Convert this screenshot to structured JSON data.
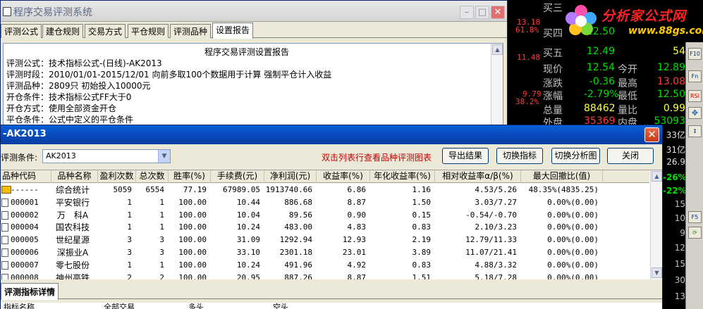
{
  "quote": {
    "left_numbers": [
      {
        "text": "13.18",
        "color": "#ff3b3b"
      },
      {
        "text": "61.8%",
        "color": "#ff3b3b"
      },
      {
        "text": "11.48",
        "color": "#ff3b3b"
      },
      {
        "text": "9.79",
        "color": "#ff3b3b"
      },
      {
        "text": "38.2%",
        "color": "#ff3b3b"
      }
    ],
    "rows": [
      {
        "l1": "买三",
        "v1": "",
        "l2": "",
        "v2": "",
        "c1": "w",
        "c2": "w"
      },
      {
        "l1": "买四",
        "v1": "12.50",
        "l2": "",
        "v2": "",
        "c1": "g",
        "c2": "y"
      },
      {
        "l1": "买五",
        "v1": "12.49",
        "l2": "",
        "v2": "54",
        "c1": "g",
        "c2": "y"
      },
      {
        "l1": "现价",
        "v1": "12.54",
        "l2": "今开",
        "v2": "12.89",
        "c1": "g",
        "c2": "g"
      },
      {
        "l1": "涨跌",
        "v1": "-0.36",
        "l2": "最高",
        "v2": "13.08",
        "c1": "g",
        "c2": "r"
      },
      {
        "l1": "涨幅",
        "v1": "-2.79%",
        "l2": "最低",
        "v2": "12.50",
        "c1": "g",
        "c2": "g"
      },
      {
        "l1": "总量",
        "v1": "88462",
        "l2": "量比",
        "v2": "0.99",
        "c1": "y",
        "c2": "y"
      },
      {
        "l1": "外盘",
        "v1": "35369",
        "l2": "内盘",
        "v2": "53093",
        "c1": "r",
        "c2": "g"
      }
    ],
    "side_values": [
      {
        "text": "33亿",
        "color": "#e0e0e0"
      },
      {
        "text": "31亿",
        "color": "#e0e0e0"
      },
      {
        "text": "26.9",
        "color": "#e0e0e0"
      },
      {
        "text": "-26%",
        "color": "#00e000"
      },
      {
        "text": "-22%",
        "color": "#00e000"
      },
      {
        "text": "15",
        "color": "#c0c0c0"
      },
      {
        "text": "10",
        "color": "#c0c0c0"
      },
      {
        "text": "9",
        "color": "#c0c0c0"
      },
      {
        "text": "12",
        "color": "#c0c0c0"
      },
      {
        "text": "15",
        "color": "#c0c0c0"
      },
      {
        "text": "30",
        "color": "#c0c0c0"
      },
      {
        "text": "13",
        "color": "#c0c0c0"
      }
    ],
    "strip_buttons": [
      "F10",
      "Fn",
      "F5"
    ]
  },
  "logo": {
    "title": "分析家公式网",
    "url": "www.88gs.com"
  },
  "settings_window": {
    "title": "程序交易评测系统",
    "tabs": [
      "评测公式",
      "建仓规则",
      "交易方式",
      "平仓规则",
      "评测品种",
      "设置报告"
    ],
    "report": {
      "title": "程序交易评测设置报告",
      "lines": [
        "评测公式：技术指标公式-(日线)-AK2013",
        "评测时段：2010/01/01-2015/12/01 向前多取100个数据用于计算 强制平仓计入收益",
        "评测品种：2809只 初始投入10000元",
        "开仓条件：技术指标公式FF大于0",
        "开仓方式：使用全部资金开仓",
        "平仓条件：公式中定义的平仓条件"
      ]
    }
  },
  "result_window": {
    "title": "-AK2013",
    "condition_label": "评测条件:",
    "condition_value": "AK2013",
    "hint": "双击列表行查看品种评测图表",
    "buttons": {
      "export": "导出结果",
      "switch_indicator": "切换指标",
      "switch_chart": "切换分析图",
      "close": "关闭"
    },
    "columns": [
      "品种代码",
      "品种名称",
      "盈利次数",
      "总次数",
      "胜率(%)",
      "手续费(元)",
      "净利润(元)",
      "收益率(%)",
      "年化收益率(%)",
      "相对收益率α/β(%)",
      "最大回撤比(值)"
    ],
    "rows": [
      {
        "code": "------",
        "name": "综合统计",
        "wins": "5059",
        "total": "6554",
        "winrate": "77.19",
        "fee": "67989.05",
        "profit": "1913740.66",
        "ret": "6.86",
        "annual": "1.16",
        "relative": "4.53/5.26",
        "drawdown": "48.35%(4835.25)",
        "summary": true
      },
      {
        "code": "000001",
        "name": "平安银行",
        "wins": "1",
        "total": "1",
        "winrate": "100.00",
        "fee": "10.44",
        "profit": "886.68",
        "ret": "8.87",
        "annual": "1.50",
        "relative": "3.03/7.27",
        "drawdown": "0.00%(0.00)",
        "summary": false
      },
      {
        "code": "000002",
        "name": "万　科A",
        "wins": "1",
        "total": "1",
        "winrate": "100.00",
        "fee": "10.04",
        "profit": "89.56",
        "ret": "0.90",
        "annual": "0.15",
        "relative": "-0.54/-0.70",
        "drawdown": "0.00%(0.00)",
        "summary": false
      },
      {
        "code": "000004",
        "name": "国农科技",
        "wins": "1",
        "total": "1",
        "winrate": "100.00",
        "fee": "10.24",
        "profit": "483.00",
        "ret": "4.83",
        "annual": "0.83",
        "relative": "2.10/3.23",
        "drawdown": "0.00%(0.00)",
        "summary": false
      },
      {
        "code": "000005",
        "name": "世纪星源",
        "wins": "3",
        "total": "3",
        "winrate": "100.00",
        "fee": "31.09",
        "profit": "1292.94",
        "ret": "12.93",
        "annual": "2.19",
        "relative": "12.79/11.33",
        "drawdown": "0.00%(0.00)",
        "summary": false
      },
      {
        "code": "000006",
        "name": "深振业A",
        "wins": "3",
        "total": "3",
        "winrate": "100.00",
        "fee": "33.10",
        "profit": "2301.18",
        "ret": "23.01",
        "annual": "3.89",
        "relative": "11.07/21.41",
        "drawdown": "0.00%(0.00)",
        "summary": false
      },
      {
        "code": "000007",
        "name": "零七股份",
        "wins": "1",
        "total": "1",
        "winrate": "100.00",
        "fee": "10.24",
        "profit": "491.96",
        "ret": "4.92",
        "annual": "0.83",
        "relative": "4.88/3.32",
        "drawdown": "0.00%(0.00)",
        "summary": false
      },
      {
        "code": "000008",
        "name": "神州高铁",
        "wins": "2",
        "total": "2",
        "winrate": "100.00",
        "fee": "20.95",
        "profit": "887.26",
        "ret": "8.87",
        "annual": "1.51",
        "relative": "5.18/7.28",
        "drawdown": "0.00%(0.00)",
        "summary": false
      }
    ],
    "detail_tab": "评测指标详情",
    "detail_columns": [
      "指标名称",
      "全部交易",
      "多头",
      "空头"
    ]
  },
  "colors": {
    "active_title": "#0a5fd6",
    "hint_red": "#c00000",
    "quote_green": "#00e000",
    "quote_red": "#ff3b3b",
    "quote_yellow": "#ffff40"
  }
}
